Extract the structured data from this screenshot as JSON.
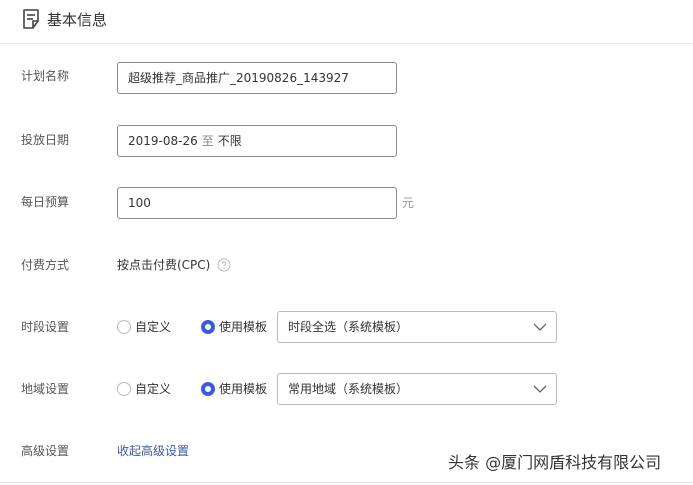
{
  "section": {
    "title": "基本信息"
  },
  "form": {
    "plan_name": {
      "label": "计划名称",
      "value": "超级推荐_商品推广_20190826_143927"
    },
    "date": {
      "label": "投放日期",
      "start": "2019-08-26",
      "separator": "至",
      "end": "不限"
    },
    "budget": {
      "label": "每日预算",
      "value": "100",
      "unit": "元"
    },
    "payment": {
      "label": "付费方式",
      "value": "按点击付费(CPC)"
    },
    "time_period": {
      "label": "时段设置",
      "option_custom": "自定义",
      "option_template": "使用模板",
      "selected": "使用模板",
      "template_value": "时段全选（系统模板）"
    },
    "region": {
      "label": "地域设置",
      "option_custom": "自定义",
      "option_template": "使用模板",
      "selected": "使用模板",
      "template_value": "常用地域（系统模板）"
    },
    "advanced": {
      "label": "高级设置",
      "link": "收起高级设置"
    }
  },
  "watermark": "头条 @厦门网盾科技有限公司",
  "colors": {
    "accent": "#3a5bd9",
    "link": "#3a5ba0",
    "border": "#8a8a8a"
  }
}
